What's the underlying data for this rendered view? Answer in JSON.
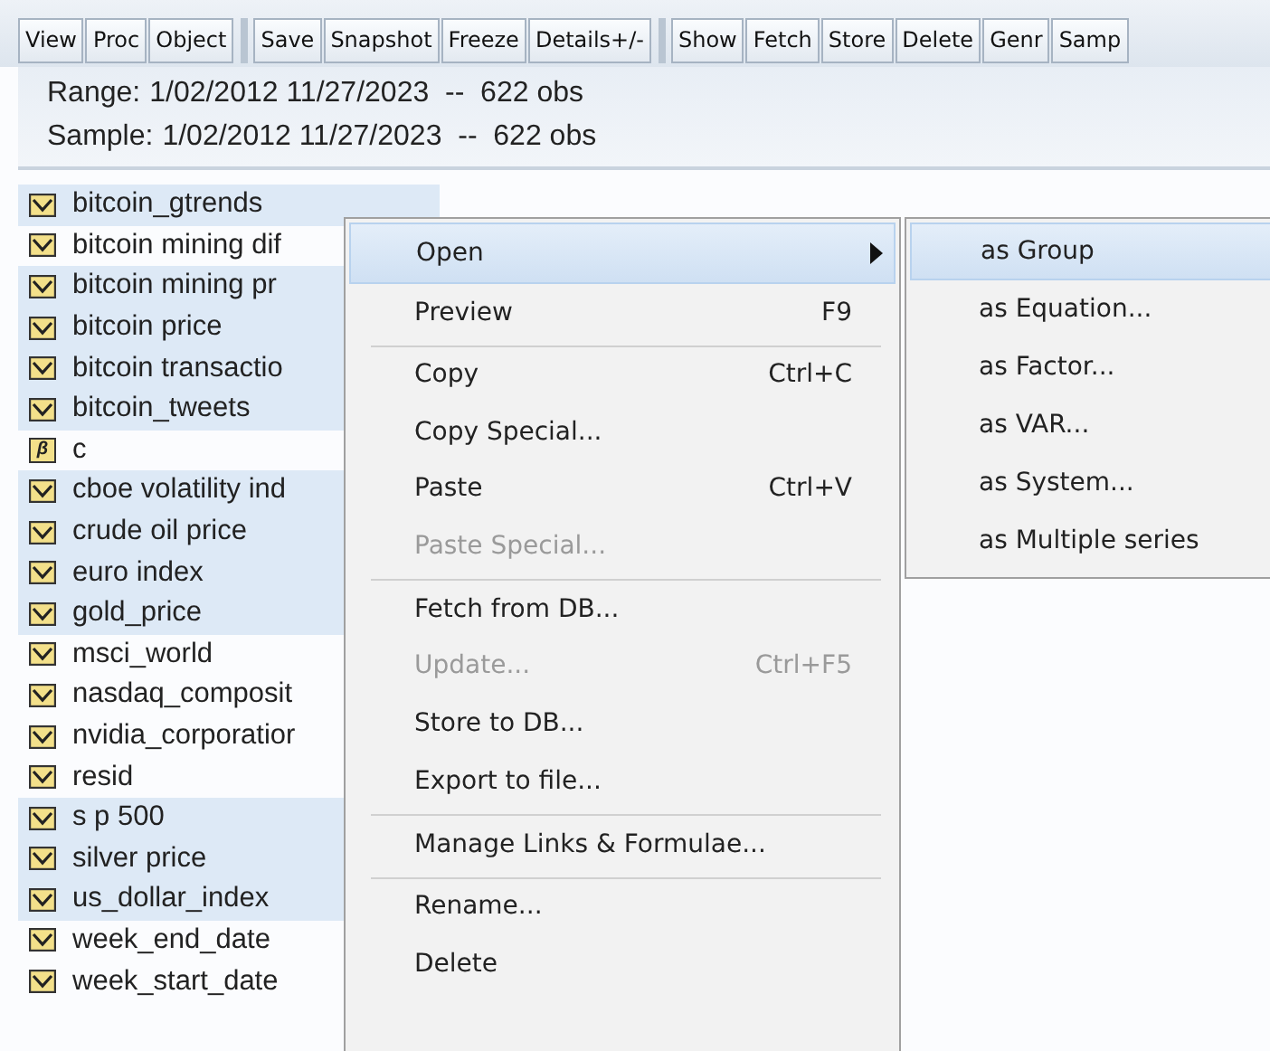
{
  "toolbar": {
    "groups": [
      [
        "View",
        "Proc",
        "Object"
      ],
      [
        "Save",
        "Snapshot",
        "Freeze",
        "Details+/-"
      ],
      [
        "Show",
        "Fetch",
        "Store",
        "Delete",
        "Genr",
        "Samp"
      ]
    ]
  },
  "range": {
    "label": "Range:",
    "value": "1/02/2012 11/27/2023  --  622 obs"
  },
  "sample": {
    "label": "Sample:",
    "value": "1/02/2012 11/27/2023  --  622 obs"
  },
  "objects": [
    {
      "name": "bitcoin_gtrends",
      "kind": "series",
      "selected": true
    },
    {
      "name": "bitcoin mining dif",
      "kind": "series",
      "selected": false
    },
    {
      "name": "bitcoin mining pr",
      "kind": "series",
      "selected": true
    },
    {
      "name": "bitcoin price",
      "kind": "series",
      "selected": true
    },
    {
      "name": "bitcoin transactio",
      "kind": "series",
      "selected": true
    },
    {
      "name": "bitcoin_tweets",
      "kind": "series",
      "selected": true
    },
    {
      "name": "c",
      "kind": "coef",
      "icon_text": "β",
      "selected": false
    },
    {
      "name": "cboe volatility ind",
      "kind": "series",
      "selected": true
    },
    {
      "name": "crude oil price",
      "kind": "series",
      "selected": true
    },
    {
      "name": "euro index",
      "kind": "series",
      "selected": true
    },
    {
      "name": "gold_price",
      "kind": "series",
      "selected": true
    },
    {
      "name": "msci_world",
      "kind": "series",
      "selected": false
    },
    {
      "name": "nasdaq_composit",
      "kind": "series",
      "selected": false
    },
    {
      "name": "nvidia_corporatior",
      "kind": "series",
      "selected": false
    },
    {
      "name": "resid",
      "kind": "series",
      "selected": false
    },
    {
      "name": "s p 500",
      "kind": "series",
      "selected": true
    },
    {
      "name": "silver price",
      "kind": "series",
      "selected": true
    },
    {
      "name": "us_dollar_index",
      "kind": "series",
      "selected": true
    },
    {
      "name": "week_end_date",
      "kind": "series",
      "selected": false
    },
    {
      "name": "week_start_date",
      "kind": "series",
      "selected": false
    }
  ],
  "context_menu": {
    "items": [
      {
        "label": "Open",
        "selected": true,
        "submenu": true,
        "disabled": false,
        "separator_after": false
      },
      {
        "label": "Preview",
        "shortcut": "F9",
        "selected": false,
        "submenu": false,
        "disabled": false,
        "separator_after": true
      },
      {
        "label": "Copy",
        "shortcut": "Ctrl+C",
        "selected": false,
        "submenu": false,
        "disabled": false,
        "separator_after": false
      },
      {
        "label": "Copy Special...",
        "selected": false,
        "submenu": false,
        "disabled": false,
        "separator_after": false
      },
      {
        "label": "Paste",
        "shortcut": "Ctrl+V",
        "selected": false,
        "submenu": false,
        "disabled": false,
        "separator_after": false
      },
      {
        "label": "Paste Special...",
        "selected": false,
        "submenu": false,
        "disabled": true,
        "separator_after": true
      },
      {
        "label": "Fetch from DB...",
        "selected": false,
        "submenu": false,
        "disabled": false,
        "separator_after": false
      },
      {
        "label": "Update...",
        "shortcut": "Ctrl+F5",
        "selected": false,
        "submenu": false,
        "disabled": true,
        "separator_after": false
      },
      {
        "label": "Store to DB...",
        "selected": false,
        "submenu": false,
        "disabled": false,
        "separator_after": false
      },
      {
        "label": "Export to file...",
        "selected": false,
        "submenu": false,
        "disabled": false,
        "separator_after": true
      },
      {
        "label": "Manage Links & Formulae...",
        "selected": false,
        "submenu": false,
        "disabled": false,
        "separator_after": true
      },
      {
        "label": "Rename...",
        "selected": false,
        "submenu": false,
        "disabled": false,
        "separator_after": false
      },
      {
        "label": "Delete",
        "selected": false,
        "submenu": false,
        "disabled": false,
        "separator_after": false
      }
    ]
  },
  "submenu": {
    "items": [
      {
        "label": "as Group",
        "selected": true
      },
      {
        "label": "as Equation...",
        "selected": false
      },
      {
        "label": "as Factor...",
        "selected": false
      },
      {
        "label": "as VAR...",
        "selected": false
      },
      {
        "label": "as System...",
        "selected": false
      },
      {
        "label": "as Multiple series",
        "selected": false
      }
    ]
  }
}
